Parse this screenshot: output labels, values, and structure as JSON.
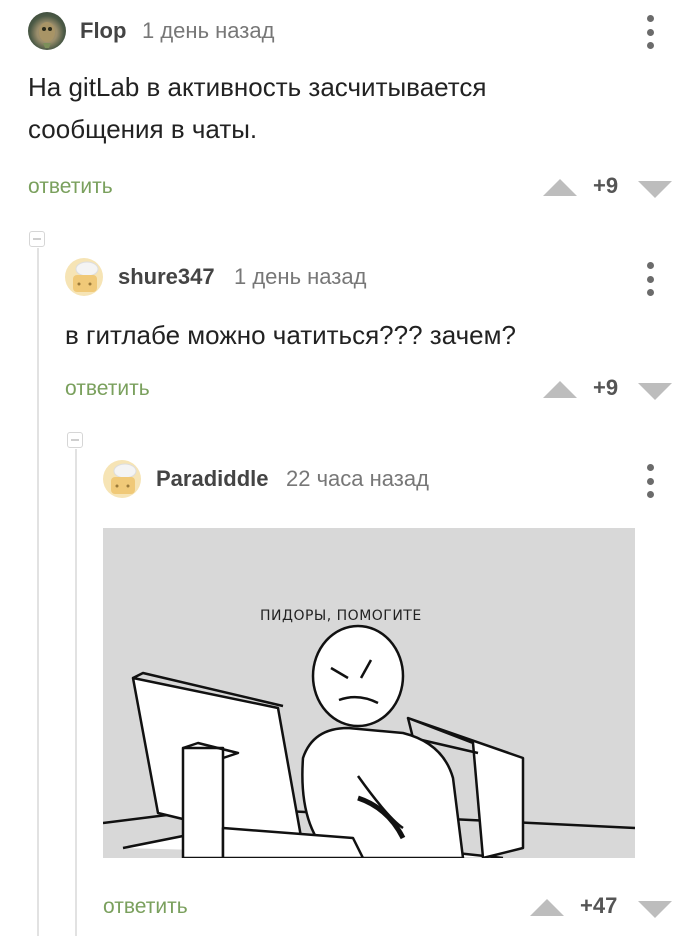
{
  "comments": [
    {
      "username": "Flop",
      "timestamp": "1 день назад",
      "avatar": "owl-avatar",
      "text": "На gitLab в  активность засчитывается сообщения в чаты.",
      "reply_label": "ответить",
      "rating": "+9"
    },
    {
      "username": "shure347",
      "timestamp": "1 день назад",
      "avatar": "default-avatar",
      "text": "в гитлабе можно чатиться??? зачем?",
      "reply_label": "ответить",
      "rating": "+9"
    },
    {
      "username": "Paradiddle",
      "timestamp": "22 часа назад",
      "avatar": "default-avatar",
      "image_caption": "ПИДОРЫ, ПОМОГИТЕ",
      "image_description": "angry person at computer meme",
      "reply_label": "ответить",
      "rating": "+47"
    }
  ],
  "colors": {
    "reply_link": "#7aa05d",
    "vote_arrow": "#bdbdbd",
    "image_bg": "#d8d8d8"
  }
}
